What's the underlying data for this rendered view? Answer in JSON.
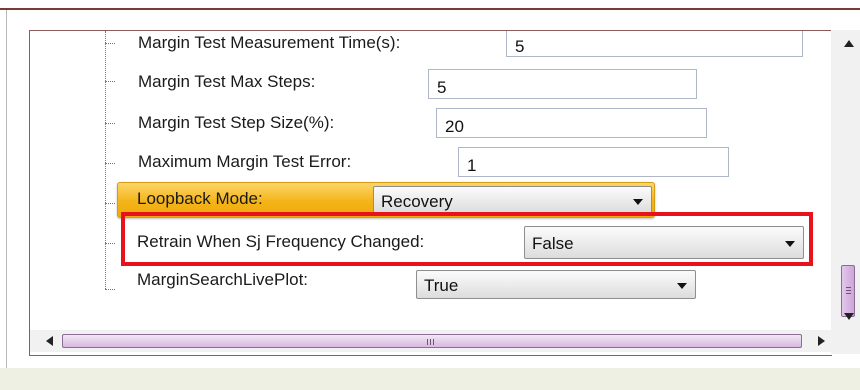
{
  "settings": {
    "rows": [
      {
        "label": "Margin Test Measurement Time(s):",
        "value": "5"
      },
      {
        "label": "Margin Test Max Steps:",
        "value": "5"
      },
      {
        "label": "Margin Test Step Size(%):",
        "value": "20"
      },
      {
        "label": "Maximum Margin Test Error:",
        "value": "1"
      }
    ],
    "loopback": {
      "label": "Loopback Mode:",
      "value": "Recovery"
    },
    "retrain": {
      "label": "Retrain When Sj Frequency Changed:",
      "value": "False"
    },
    "live_plot": {
      "label": "MarginSearchLivePlot:",
      "value": "True"
    }
  },
  "colors": {
    "highlight": "#f4b418",
    "callout": "#e8121c",
    "scrollbar_thumb": "#cca6d8"
  },
  "icons": {
    "dropdown": "chevron-down-icon",
    "scroll_up": "arrow-up-icon",
    "scroll_down": "arrow-down-icon",
    "scroll_left": "arrow-left-icon",
    "scroll_right": "arrow-right-icon"
  }
}
